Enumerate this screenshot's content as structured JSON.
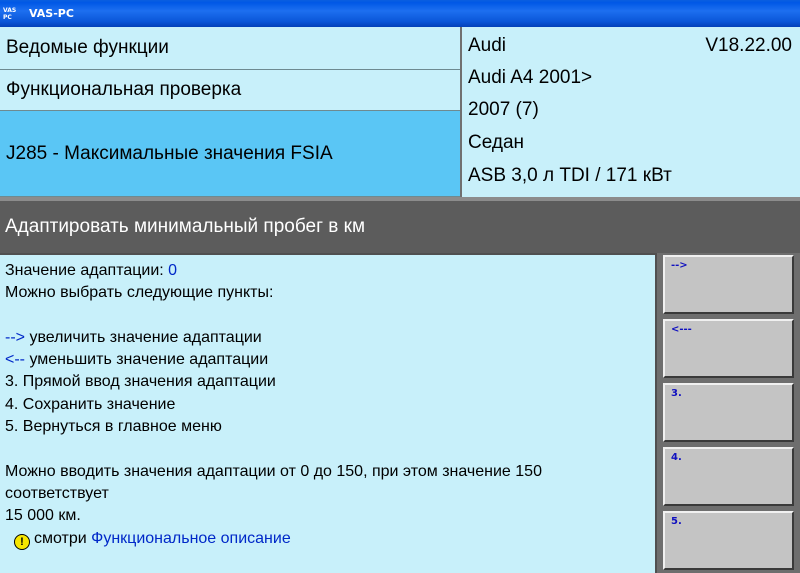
{
  "window": {
    "title": "VAS-PC",
    "icon_text": "VAS PC"
  },
  "nav": {
    "item1": "Ведомые функции",
    "item2": "Функциональная проверка",
    "item3": "J285 - Максимальные значения FSIA"
  },
  "vehicle": {
    "make": "Audi",
    "version": "V18.22.00",
    "model": "Audi A4 2001>",
    "year": "2007 (7)",
    "body": "Седан",
    "engine": "ASB 3,0 л TDI / 171 кВт"
  },
  "section": {
    "title": "Адаптировать минимальный пробег в км"
  },
  "content": {
    "adaptation_label": "Значение адаптации: ",
    "adaptation_value": "0",
    "choose_label": " Можно выбрать следующие пункты:",
    "opt1_key": "-->",
    "opt1_text": " увеличить значение адаптации",
    "opt2_key": " <--",
    "opt2_text": " уменьшить значение адаптации",
    "opt3": " 3. Прямой ввод значения адаптации",
    "opt4": " 4. Сохранить значение",
    "opt5": " 5. Вернуться в главное меню",
    "range_line1": "Можно вводить значения адаптации от 0 до 150, при этом значение 150",
    "range_line2": "соответствует",
    "range_line3": "15 000 км.",
    "see_label": "смотри ",
    "see_link": "Функциональное описание",
    "warn_symbol": "!"
  },
  "buttons": {
    "b1": "-->",
    "b2": "<---",
    "b3": "3.",
    "b4": "4.",
    "b5": "5."
  }
}
